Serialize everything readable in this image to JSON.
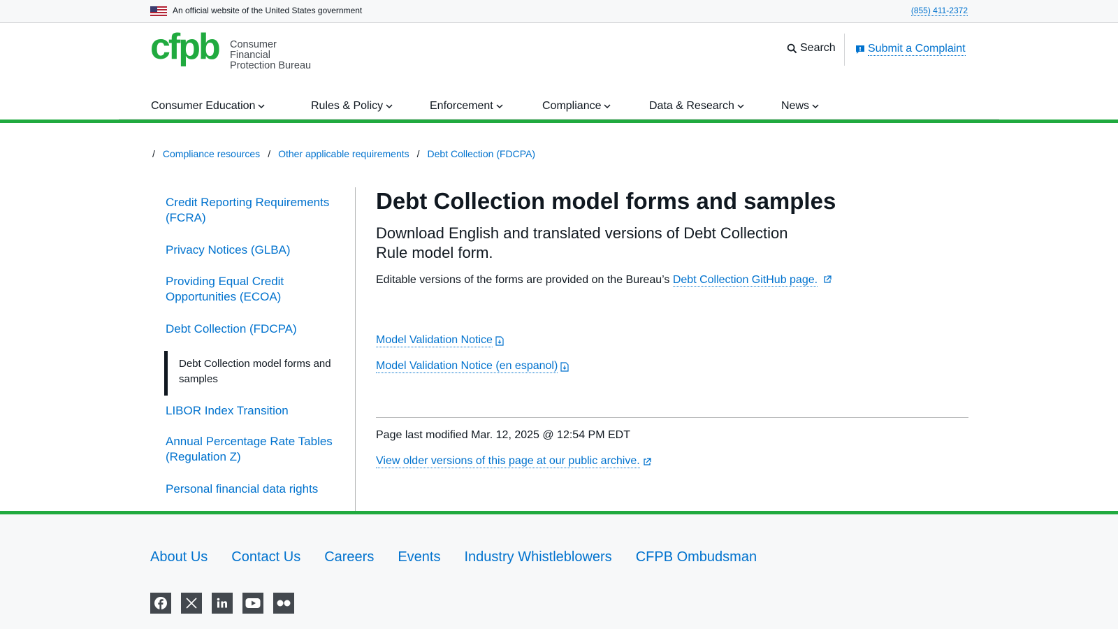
{
  "banner": {
    "official_text": "An official website of the United States government",
    "phone": "(855) 411-2372"
  },
  "header": {
    "logo_word": "cfpb",
    "logo_name_line1": "Consumer Financial",
    "logo_name_line2": "Protection Bureau",
    "search_label": "Search",
    "complaint_label": "Submit a Complaint"
  },
  "nav": {
    "items": [
      {
        "label": "Consumer Education"
      },
      {
        "label": "Rules & Policy"
      },
      {
        "label": "Enforcement"
      },
      {
        "label": "Compliance"
      },
      {
        "label": "Data & Research"
      },
      {
        "label": "News"
      }
    ],
    "active": "Compliance"
  },
  "breadcrumb": {
    "items": [
      "Compliance resources",
      "Other applicable requirements",
      "Debt Collection (FDCPA)"
    ]
  },
  "sidebar": {
    "items": [
      "Credit Reporting Requirements (FCRA)",
      "Privacy Notices (GLBA)",
      "Providing Equal Credit Opportunities (ECOA)",
      "Debt Collection (FDCPA)",
      "Debt Collection model forms and samples",
      "LIBOR Index Transition",
      "Annual Percentage Rate Tables (Regulation Z)",
      "Personal financial data rights"
    ]
  },
  "content": {
    "title": "Debt Collection model forms and samples",
    "lead": "Download English and translated versions of Debt Collection Rule model form.",
    "editable_text": "Editable versions of the forms are provided on the Bureau’s ",
    "github_link": "Debt Collection GitHub page.",
    "documents": [
      "Model Validation Notice",
      "Model Validation Notice (en espanol)"
    ],
    "last_modified": "Page last modified Mar. 12, 2025 @ 12:54 PM EDT",
    "archive_link": "View older versions of this page at our public archive."
  },
  "footer": {
    "links": [
      "About Us",
      "Contact Us",
      "Careers",
      "Events",
      "Industry Whistleblowers",
      "CFPB Ombudsman"
    ],
    "social": [
      "facebook-icon",
      "x-icon",
      "linkedin-icon",
      "youtube-icon",
      "flickr-icon"
    ]
  },
  "colors": {
    "brand_green": "#20aa3f",
    "link_blue": "#0072ce",
    "text": "#101820"
  }
}
